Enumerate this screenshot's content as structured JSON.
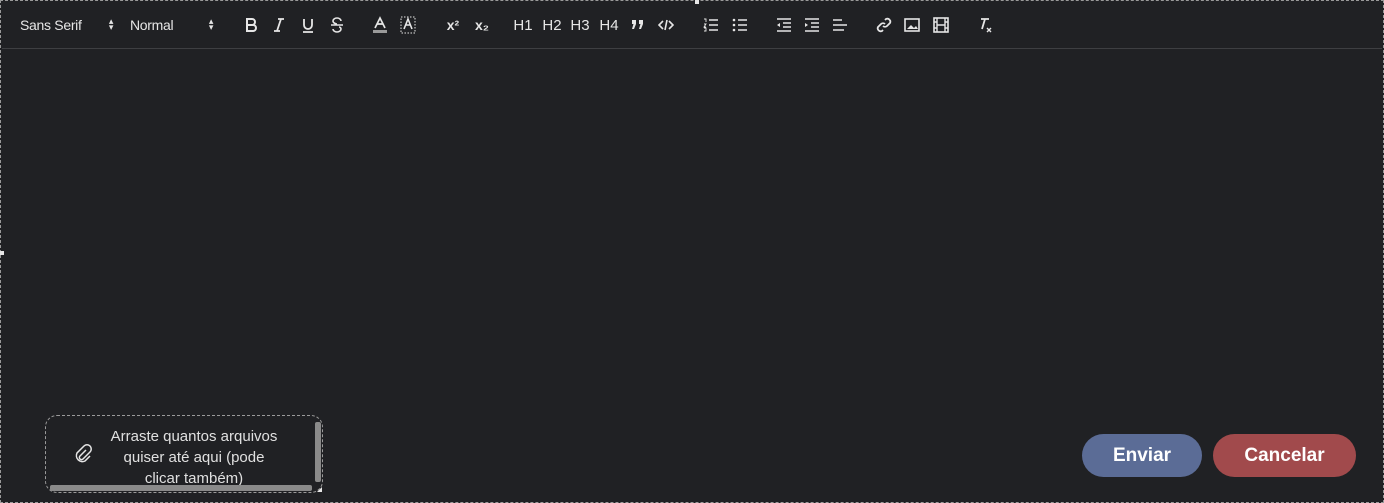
{
  "toolbar": {
    "font_family": "Sans Serif",
    "font_size": "Normal",
    "caret_up": "▴",
    "caret_down": "▾",
    "headings": [
      "H1",
      "H2",
      "H3",
      "H4"
    ],
    "superscript": "x²",
    "subscript": "x₂"
  },
  "dropzone": {
    "text": "Arraste quantos arquivos quiser até aqui (pode clicar também)"
  },
  "actions": {
    "send_label": "Enviar",
    "cancel_label": "Cancelar"
  },
  "colors": {
    "background": "#202124",
    "send": "#5b6c96",
    "cancel": "#a14a4c"
  }
}
